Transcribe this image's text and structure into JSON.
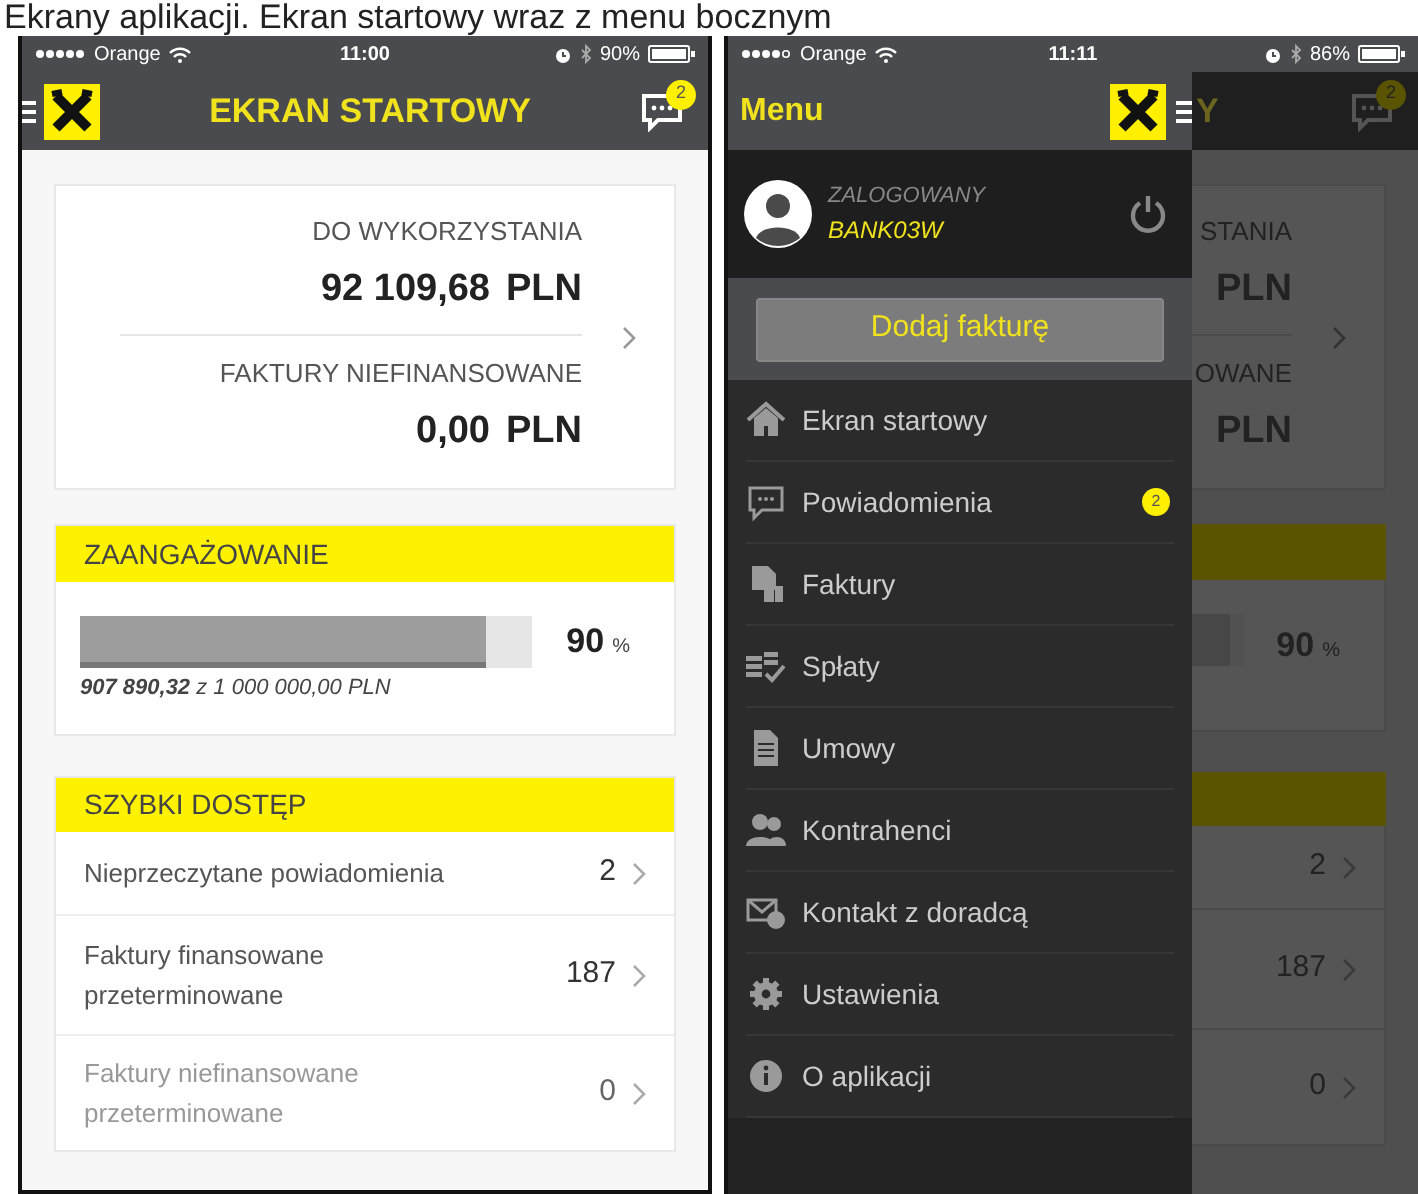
{
  "caption": "Ekrany aplikacji. Ekran startowy wraz z menu bocznym",
  "home_screen": {
    "status_bar": {
      "carrier": "Orange",
      "time": "11:00",
      "battery": "90%"
    },
    "title": "EKRAN STARTOWY",
    "notification_badge": "2",
    "balance": {
      "label": "DO WYKORZYSTANIA",
      "amount": "92 109,68",
      "currency": "PLN"
    },
    "unfinanced": {
      "label": "FAKTURY NIEFINANSOWANE",
      "amount": "0,00",
      "currency": "PLN"
    },
    "engagement": {
      "heading": "ZAANGAŻOWANIE",
      "level": 0.9,
      "percent": "90",
      "percent_sign": "%",
      "usage_text": "**907 890,32** z 1 000 000,00 PLN"
    },
    "quick_access": {
      "heading": "SZYBKI DOSTĘP",
      "items": [
        {
          "label": "Nieprzeczytane powiadomienia",
          "count": "2",
          "disabled": false
        },
        {
          "label": "Faktury finansowane przeterminowane",
          "count": "187",
          "disabled": false
        },
        {
          "label": "Faktury niefinansowane przeterminowane",
          "count": "0",
          "disabled": true
        }
      ]
    }
  },
  "menu_screen": {
    "status_bar": {
      "carrier": "Orange",
      "time": "11:11",
      "battery": "86%"
    },
    "menu_title": "Menu",
    "user": {
      "status": "ZALOGOWANY",
      "name": "BANK03W"
    },
    "add_button": "Dodaj fakturę",
    "items": [
      {
        "kind": "home",
        "label": "Ekran startowy"
      },
      {
        "kind": "notifications",
        "label": "Powiadomienia",
        "badge": "2"
      },
      {
        "kind": "invoices",
        "label": "Faktury"
      },
      {
        "kind": "payments",
        "label": "Spłaty"
      },
      {
        "kind": "contracts",
        "label": "Umowy"
      },
      {
        "kind": "contractors",
        "label": "Kontrahenci"
      },
      {
        "kind": "contact",
        "label": "Kontakt z doradcą"
      },
      {
        "kind": "settings",
        "label": "Ustawienia"
      },
      {
        "kind": "about",
        "label": "O aplikacji"
      }
    ],
    "background": {
      "title_fragment": "Y",
      "badge": "2",
      "balance_label": "STANIA",
      "balance_currency": "PLN",
      "unfinanced_label": "OWANE",
      "unfinanced_currency": "PLN",
      "percent": "90",
      "percent_sign": "%",
      "counts": [
        "2",
        "187",
        "0"
      ]
    }
  }
}
